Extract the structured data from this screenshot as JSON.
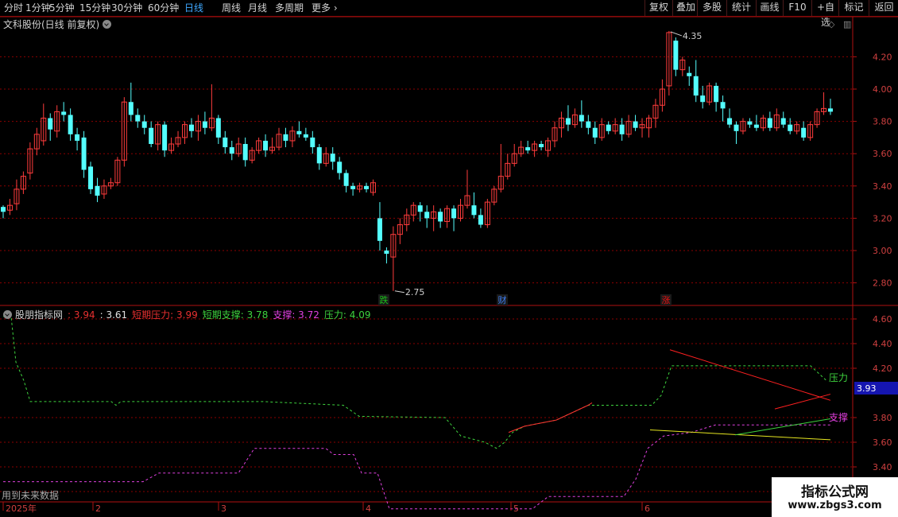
{
  "toolbar": {
    "left": [
      {
        "label": "分时",
        "active": false
      },
      {
        "label": "1分钟",
        "active": false
      },
      {
        "label": "5分钟",
        "active": false
      },
      {
        "label": "15分钟",
        "active": false
      },
      {
        "label": "30分钟",
        "active": false
      },
      {
        "label": "60分钟",
        "active": false
      },
      {
        "label": "日线",
        "active": true
      },
      {
        "label": "周线",
        "active": false
      },
      {
        "label": "月线",
        "active": false
      },
      {
        "label": "多周期",
        "active": false
      },
      {
        "label": "更多",
        "active": false
      }
    ],
    "right": [
      "复权",
      "叠加",
      "多股",
      "统计",
      "画线",
      "F10",
      "+自选",
      "标记",
      "返回"
    ]
  },
  "price_panel": {
    "title": "文科股份(日线 前复权)",
    "y_ticks": [
      "4.20",
      "4.00",
      "3.80",
      "3.60",
      "3.40",
      "3.20",
      "3.00",
      "2.80"
    ],
    "high_label": "4.35",
    "low_label": "2.75",
    "events": [
      {
        "label": "跌",
        "color": "#19c219"
      },
      {
        "label": "财",
        "color": "#3c7df0"
      },
      {
        "label": "涨",
        "color": "#e81010"
      }
    ]
  },
  "indicator_panel": {
    "name": "股朋指标网",
    "values": [
      {
        "label": "",
        "value": "3.94",
        "color": "#e83030"
      },
      {
        "label": "",
        "value": "3.61",
        "color": "#e0e0e0"
      },
      {
        "label": "短期压力",
        "value": "3.99",
        "color": "#e83030"
      },
      {
        "label": "短期支撑",
        "value": "3.78",
        "color": "#3ed33e"
      },
      {
        "label": "支撑",
        "value": "3.72",
        "color": "#e040e0"
      },
      {
        "label": "压力",
        "value": "4.09",
        "color": "#3ed33e"
      }
    ],
    "y_ticks": [
      "4.60",
      "4.40",
      "4.20",
      "3.80",
      "3.60",
      "3.40",
      "3.20"
    ],
    "current_badge": "3.93",
    "label_pressure": "压力",
    "label_support": "支撑",
    "future_note": "用到未来数据"
  },
  "x_axis": {
    "labels": [
      "2025年",
      "2",
      "3",
      "4",
      "5",
      "6"
    ]
  },
  "watermark": {
    "line1": "指标公式网",
    "line2": "www.zbgs3.com"
  },
  "colors": {
    "up": "#ff3c3c",
    "down": "#54ffff",
    "grid": "#8b0000",
    "green_dash": "#3ed33e",
    "magenta_dash": "#e040e0",
    "yellow": "#e6e620"
  },
  "chart_data": {
    "type": "candlestick",
    "y_unit": "price",
    "ylim": [
      2.7,
      4.4
    ],
    "candles": [
      [
        3.27,
        3.24,
        3.28,
        3.2
      ],
      [
        3.25,
        3.28,
        3.32,
        3.22
      ],
      [
        3.29,
        3.38,
        3.44,
        3.25
      ],
      [
        3.38,
        3.46,
        3.49,
        3.35
      ],
      [
        3.48,
        3.63,
        3.67,
        3.44
      ],
      [
        3.63,
        3.72,
        3.76,
        3.59
      ],
      [
        3.68,
        3.82,
        3.91,
        3.65
      ],
      [
        3.82,
        3.75,
        3.85,
        3.68
      ],
      [
        3.74,
        3.86,
        3.9,
        3.7
      ],
      [
        3.86,
        3.84,
        3.92,
        3.8
      ],
      [
        3.84,
        3.72,
        3.88,
        3.68
      ],
      [
        3.72,
        3.68,
        3.76,
        3.62
      ],
      [
        3.7,
        3.5,
        3.74,
        3.45
      ],
      [
        3.52,
        3.38,
        3.55,
        3.35
      ],
      [
        3.4,
        3.34,
        3.45,
        3.3
      ],
      [
        3.35,
        3.4,
        3.44,
        3.32
      ],
      [
        3.4,
        3.42,
        3.45,
        3.38
      ],
      [
        3.42,
        3.56,
        3.58,
        3.4
      ],
      [
        3.56,
        3.92,
        3.95,
        3.52
      ],
      [
        3.92,
        3.84,
        4.04,
        3.8
      ],
      [
        3.84,
        3.8,
        3.88,
        3.76
      ],
      [
        3.8,
        3.76,
        3.84,
        3.72
      ],
      [
        3.76,
        3.66,
        3.8,
        3.64
      ],
      [
        3.66,
        3.78,
        3.8,
        3.62
      ],
      [
        3.78,
        3.62,
        3.8,
        3.58
      ],
      [
        3.62,
        3.66,
        3.7,
        3.6
      ],
      [
        3.66,
        3.7,
        3.74,
        3.64
      ],
      [
        3.7,
        3.78,
        3.8,
        3.66
      ],
      [
        3.78,
        3.74,
        3.82,
        3.7
      ],
      [
        3.74,
        3.8,
        3.84,
        3.68
      ],
      [
        3.8,
        3.76,
        3.86,
        3.72
      ],
      [
        3.76,
        3.82,
        4.03,
        3.74
      ],
      [
        3.82,
        3.7,
        3.84,
        3.66
      ],
      [
        3.7,
        3.64,
        3.74,
        3.6
      ],
      [
        3.64,
        3.6,
        3.68,
        3.56
      ],
      [
        3.6,
        3.66,
        3.7,
        3.58
      ],
      [
        3.66,
        3.56,
        3.7,
        3.52
      ],
      [
        3.56,
        3.62,
        3.64,
        3.54
      ],
      [
        3.62,
        3.68,
        3.7,
        3.6
      ],
      [
        3.68,
        3.62,
        3.72,
        3.58
      ],
      [
        3.62,
        3.64,
        3.7,
        3.6
      ],
      [
        3.64,
        3.72,
        3.76,
        3.62
      ],
      [
        3.72,
        3.68,
        3.76,
        3.64
      ],
      [
        3.68,
        3.74,
        3.77,
        3.64
      ],
      [
        3.74,
        3.72,
        3.8,
        3.7
      ],
      [
        3.72,
        3.7,
        3.76,
        3.68
      ],
      [
        3.7,
        3.64,
        3.74,
        3.6
      ],
      [
        3.64,
        3.54,
        3.66,
        3.5
      ],
      [
        3.54,
        3.6,
        3.64,
        3.52
      ],
      [
        3.6,
        3.55,
        3.64,
        3.5
      ],
      [
        3.55,
        3.48,
        3.58,
        3.44
      ],
      [
        3.48,
        3.4,
        3.5,
        3.36
      ],
      [
        3.4,
        3.38,
        3.42,
        3.34
      ],
      [
        3.38,
        3.4,
        3.42,
        3.36
      ],
      [
        3.4,
        3.38,
        3.42,
        3.36
      ],
      [
        3.36,
        3.42,
        3.44,
        3.34
      ],
      [
        3.2,
        3.06,
        3.3,
        3.0
      ],
      [
        3.0,
        2.98,
        3.02,
        2.92
      ],
      [
        2.96,
        3.1,
        3.15,
        2.75
      ],
      [
        3.1,
        3.16,
        3.2,
        3.04
      ],
      [
        3.16,
        3.22,
        3.26,
        3.12
      ],
      [
        3.22,
        3.28,
        3.3,
        3.18
      ],
      [
        3.28,
        3.24,
        3.3,
        3.18
      ],
      [
        3.24,
        3.2,
        3.28,
        3.14
      ],
      [
        3.2,
        3.24,
        3.28,
        3.12
      ],
      [
        3.24,
        3.18,
        3.26,
        3.14
      ],
      [
        3.18,
        3.26,
        3.28,
        3.14
      ],
      [
        3.26,
        3.2,
        3.28,
        3.12
      ],
      [
        3.2,
        3.28,
        3.32,
        3.18
      ],
      [
        3.28,
        3.34,
        3.5,
        3.26
      ],
      [
        3.28,
        3.22,
        3.36,
        3.2
      ],
      [
        3.22,
        3.16,
        3.26,
        3.14
      ],
      [
        3.16,
        3.3,
        3.32,
        3.14
      ],
      [
        3.3,
        3.38,
        3.4,
        3.28
      ],
      [
        3.38,
        3.46,
        3.66,
        3.36
      ],
      [
        3.46,
        3.54,
        3.6,
        3.44
      ],
      [
        3.54,
        3.6,
        3.66,
        3.52
      ],
      [
        3.6,
        3.64,
        3.68,
        3.58
      ],
      [
        3.64,
        3.62,
        3.68,
        3.6
      ],
      [
        3.62,
        3.66,
        3.68,
        3.58
      ],
      [
        3.66,
        3.64,
        3.68,
        3.62
      ],
      [
        3.62,
        3.68,
        3.7,
        3.58
      ],
      [
        3.68,
        3.76,
        3.8,
        3.64
      ],
      [
        3.76,
        3.82,
        3.86,
        3.7
      ],
      [
        3.82,
        3.78,
        3.9,
        3.74
      ],
      [
        3.78,
        3.84,
        3.88,
        3.76
      ],
      [
        3.84,
        3.8,
        3.93,
        3.76
      ],
      [
        3.8,
        3.76,
        3.84,
        3.72
      ],
      [
        3.76,
        3.7,
        3.8,
        3.66
      ],
      [
        3.7,
        3.78,
        3.82,
        3.68
      ],
      [
        3.78,
        3.74,
        3.8,
        3.72
      ],
      [
        3.74,
        3.78,
        3.82,
        3.72
      ],
      [
        3.78,
        3.72,
        3.82,
        3.68
      ],
      [
        3.72,
        3.8,
        3.84,
        3.7
      ],
      [
        3.8,
        3.76,
        3.84,
        3.74
      ],
      [
        3.76,
        3.78,
        3.82,
        3.7
      ],
      [
        3.76,
        3.82,
        3.84,
        3.7
      ],
      [
        3.82,
        3.9,
        3.94,
        3.76
      ],
      [
        3.9,
        4.0,
        4.06,
        3.86
      ],
      [
        4.02,
        4.35,
        4.36,
        3.96
      ],
      [
        4.3,
        4.12,
        4.32,
        4.08
      ],
      [
        4.12,
        4.18,
        4.2,
        4.08
      ],
      [
        4.1,
        4.08,
        4.14,
        4.02
      ],
      [
        4.08,
        3.96,
        4.18,
        3.92
      ],
      [
        3.96,
        3.92,
        4.02,
        3.88
      ],
      [
        3.92,
        4.02,
        4.04,
        3.9
      ],
      [
        4.02,
        3.92,
        4.04,
        3.86
      ],
      [
        3.92,
        3.88,
        3.96,
        3.8
      ],
      [
        3.82,
        3.78,
        3.88,
        3.76
      ],
      [
        3.78,
        3.74,
        3.8,
        3.66
      ],
      [
        3.74,
        3.8,
        3.82,
        3.72
      ],
      [
        3.8,
        3.78,
        3.82,
        3.76
      ],
      [
        3.78,
        3.76,
        3.84,
        3.74
      ],
      [
        3.76,
        3.82,
        3.84,
        3.74
      ],
      [
        3.82,
        3.76,
        3.86,
        3.74
      ],
      [
        3.76,
        3.84,
        3.88,
        3.74
      ],
      [
        3.82,
        3.78,
        3.86,
        3.76
      ],
      [
        3.78,
        3.74,
        3.82,
        3.72
      ],
      [
        3.74,
        3.78,
        3.8,
        3.72
      ],
      [
        3.76,
        3.7,
        3.8,
        3.68
      ],
      [
        3.7,
        3.78,
        3.8,
        3.68
      ],
      [
        3.78,
        3.86,
        3.88,
        3.76
      ],
      [
        3.86,
        3.88,
        3.98,
        3.84
      ],
      [
        3.88,
        3.86,
        3.94,
        3.84
      ]
    ]
  }
}
